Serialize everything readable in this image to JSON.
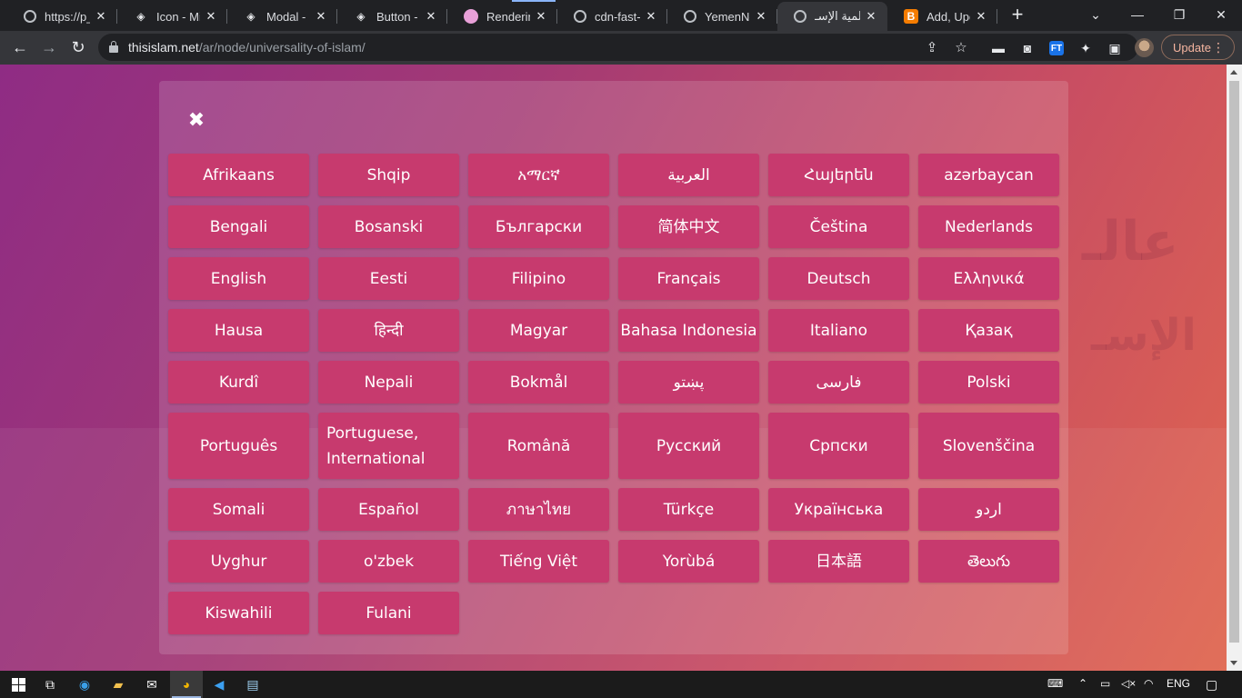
{
  "tabs": [
    {
      "title": "https://p_t",
      "favicon": "globe-icon"
    },
    {
      "title": "Icon - Midi",
      "favicon": "stack-icon"
    },
    {
      "title": "Modal - M",
      "favicon": "stack-icon"
    },
    {
      "title": "Button - M",
      "favicon": "stack-icon"
    },
    {
      "title": "Rendering",
      "favicon": "pink-icon"
    },
    {
      "title": "cdn-fast-m",
      "favicon": "globe-icon"
    },
    {
      "title": "YemenNet",
      "favicon": "globe-icon"
    },
    {
      "title": "عالمية الإسـ",
      "favicon": "globe-icon",
      "active": true
    },
    {
      "title": "Add, Upda",
      "favicon": "blogger-icon"
    }
  ],
  "address": {
    "host": "thisislam.net",
    "path": "/ar/node/universality-of-islam/"
  },
  "update_label": "Update",
  "modal": {
    "close_glyph": "✖",
    "languages": [
      "Afrikaans",
      "Shqip",
      "አማርኛ",
      "العربية",
      "Հայերեն",
      "azərbaycan",
      "Bengali",
      "Bosanski",
      "Български",
      "简体中文",
      "Čeština",
      "Nederlands",
      "English",
      "Eesti",
      "Filipino",
      "Français",
      "Deutsch",
      "Ελληνικά",
      "Hausa",
      "हिन्दी",
      "Magyar",
      "Bahasa Indonesia",
      "Italiano",
      "Қазақ",
      "Kurdî",
      "Nepali",
      "Bokmål",
      "پښتو",
      "فارسی",
      "Polski",
      "Português",
      "Portuguese, International",
      "Română",
      "Русский",
      "Српски",
      "Slovenščina",
      "Somali",
      "Español",
      "ภาษาไทย",
      "Türkçe",
      "Українська",
      "اردو",
      "Uyghur",
      "o'zbek",
      "Tiếng Việt",
      "Yorùbá",
      "日本語",
      "తెలుగు",
      "Kiswahili",
      "Fulani"
    ]
  },
  "taskbar": {
    "lang": "ENG"
  }
}
